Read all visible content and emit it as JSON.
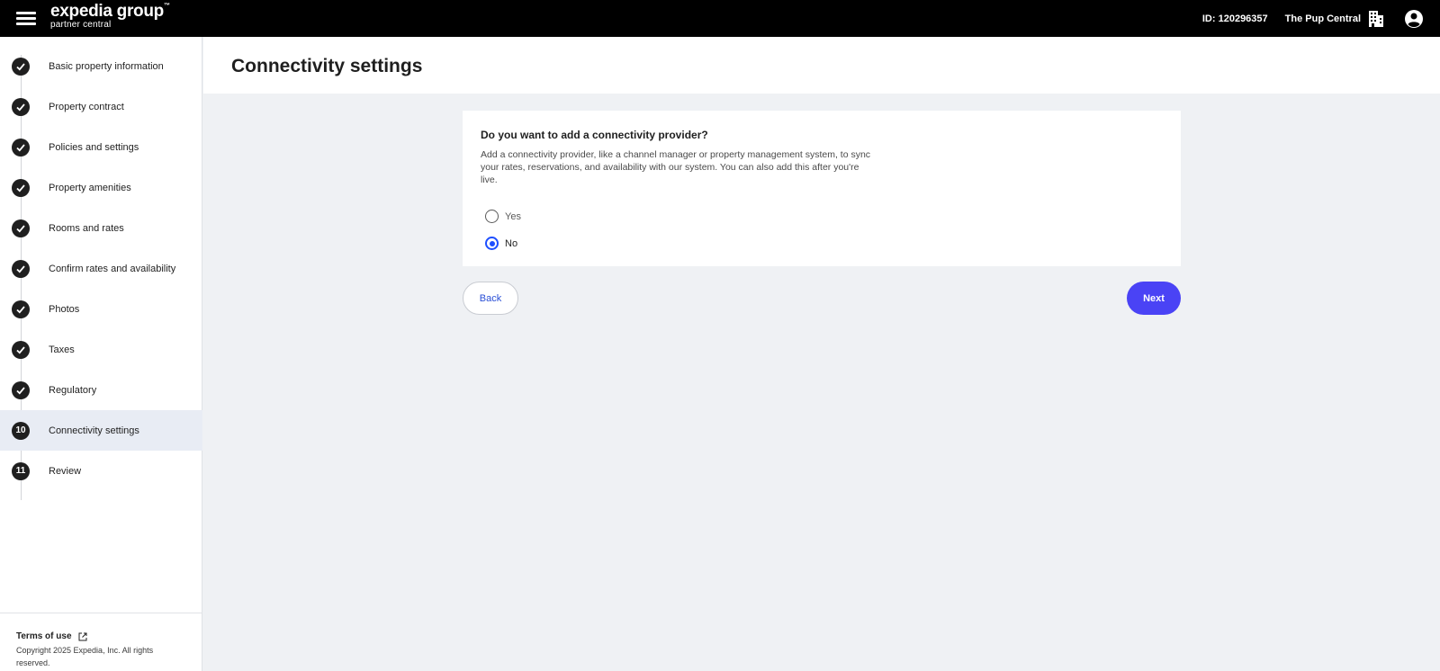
{
  "header": {
    "logo_main": "expedia group",
    "logo_tm": "™",
    "logo_sub": "partner central",
    "property_id": "ID: 120296357",
    "property_name": "The Pup Central"
  },
  "sidebar": {
    "steps": [
      {
        "marker": "",
        "label": "Basic property information",
        "completed": true
      },
      {
        "marker": "",
        "label": "Property contract",
        "completed": true
      },
      {
        "marker": "",
        "label": "Policies and settings",
        "completed": true
      },
      {
        "marker": "",
        "label": "Property amenities",
        "completed": true
      },
      {
        "marker": "",
        "label": "Rooms and rates",
        "completed": true
      },
      {
        "marker": "",
        "label": "Confirm rates and availability",
        "completed": true
      },
      {
        "marker": "",
        "label": "Photos",
        "completed": true
      },
      {
        "marker": "",
        "label": "Taxes",
        "completed": true
      },
      {
        "marker": "",
        "label": "Regulatory",
        "completed": true
      },
      {
        "marker": "10",
        "label": "Connectivity settings",
        "completed": false,
        "active": true
      },
      {
        "marker": "11",
        "label": "Review",
        "completed": false
      }
    ],
    "footer": {
      "terms": "Terms of use",
      "copyright": "Copyright 2025 Expedia, Inc. All rights reserved."
    }
  },
  "main": {
    "title": "Connectivity settings",
    "question": "Do you want to add a connectivity provider?",
    "description": "Add a connectivity provider, like a channel manager or property management system, to sync your rates, reservations, and availability with our system. You can also add this after you're live.",
    "options": [
      {
        "label": "Yes",
        "selected": false
      },
      {
        "label": "No",
        "selected": true
      }
    ],
    "back_label": "Back",
    "next_label": "Next"
  },
  "colors": {
    "accent": "#1e4fff",
    "primary_button": "#4a43f5",
    "topbar": "#000000",
    "active_step_bg": "#e8ecf4",
    "page_bg": "#eff1f4"
  },
  "icons": {
    "menu": "hamburger-icon",
    "building": "building-icon",
    "account": "account-circle-icon",
    "check": "check-icon",
    "external": "external-link-icon"
  }
}
